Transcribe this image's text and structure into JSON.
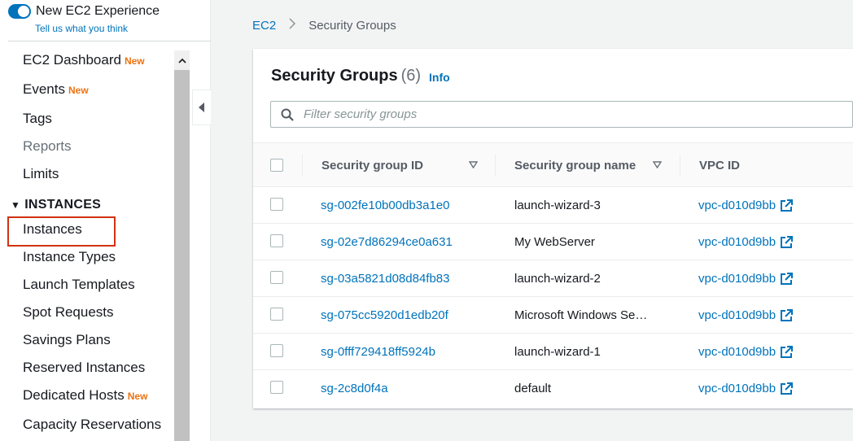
{
  "sidebar": {
    "experience_toggle_label": "New EC2 Experience",
    "feedback_link": "Tell us what you think",
    "new_badge": "New",
    "items": [
      {
        "label": "EC2 Dashboard",
        "badge": "New"
      },
      {
        "label": "Events",
        "badge": "New"
      },
      {
        "label": "Tags"
      },
      {
        "label": "Reports"
      },
      {
        "label": "Limits"
      }
    ],
    "section_instances": "INSTANCES",
    "instances_items": [
      {
        "label": "Instances"
      },
      {
        "label": "Instance Types"
      },
      {
        "label": "Launch Templates"
      },
      {
        "label": "Spot Requests"
      },
      {
        "label": "Savings Plans"
      },
      {
        "label": "Reserved Instances"
      },
      {
        "label": "Dedicated Hosts",
        "badge": "New"
      },
      {
        "label": "Capacity Reservations"
      }
    ]
  },
  "breadcrumb": {
    "root": "EC2",
    "current": "Security Groups"
  },
  "panel": {
    "title": "Security Groups",
    "count": "(6)",
    "info": "Info",
    "filter_placeholder": "Filter security groups"
  },
  "table": {
    "columns": [
      "Security group ID",
      "Security group name",
      "VPC ID"
    ],
    "rows": [
      {
        "id": "sg-002fe10b00db3a1e0",
        "name": "launch-wizard-3",
        "vpc": "vpc-d010d9bb"
      },
      {
        "id": "sg-02e7d86294ce0a631",
        "name": "My WebServer",
        "vpc": "vpc-d010d9bb"
      },
      {
        "id": "sg-03a5821d08d84fb83",
        "name": "launch-wizard-2",
        "vpc": "vpc-d010d9bb"
      },
      {
        "id": "sg-075cc5920d1edb20f",
        "name": "Microsoft Windows Se…",
        "vpc": "vpc-d010d9bb"
      },
      {
        "id": "sg-0fff729418ff5924b",
        "name": "launch-wizard-1",
        "vpc": "vpc-d010d9bb"
      },
      {
        "id": "sg-2c8d0f4a",
        "name": "default",
        "vpc": "vpc-d010d9bb"
      }
    ]
  },
  "colors": {
    "link": "#0073bb",
    "badge_new": "#ec7211",
    "highlight": "#d13212"
  }
}
